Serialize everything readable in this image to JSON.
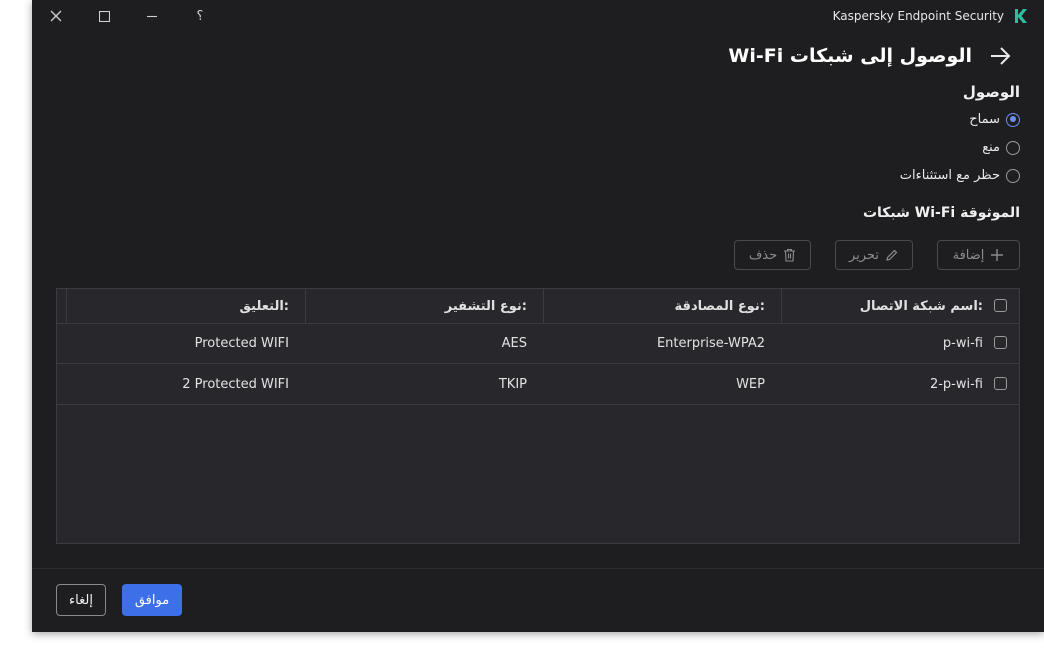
{
  "window": {
    "app_title": "Kaspersky Endpoint Security",
    "help_label": "؟",
    "brand_color": "#29c0a0"
  },
  "page": {
    "title": "الوصول إلى شبكات Wi-Fi"
  },
  "access": {
    "label": "الوصول",
    "options": [
      {
        "label": "سماح",
        "selected": true
      },
      {
        "label": "منع",
        "selected": false
      },
      {
        "label": "حظر مع استثناءات",
        "selected": false
      }
    ]
  },
  "trusted_networks": {
    "label": "شبكات Wi-Fi الموثوقة",
    "toolbar": {
      "add_label": "إضافة",
      "edit_label": "تحرير",
      "delete_label": "حذف"
    },
    "columns": [
      "اسم شبكة الاتصال:",
      "نوع المصادقة:",
      "نوع التشفير:",
      "التعليق:"
    ],
    "rows": [
      {
        "name": "p-wi-fi",
        "auth": "Enterprise-WPA2",
        "encryption": "AES",
        "comment": "Protected WIFI"
      },
      {
        "name": "2-p-wi-fi",
        "auth": "WEP",
        "encryption": "TKIP",
        "comment": "2 Protected WIFI"
      }
    ]
  },
  "footer": {
    "ok_label": "موافق",
    "cancel_label": "إلغاء"
  },
  "colors": {
    "accent": "#3d6fe8",
    "background": "#1e1e20",
    "table_background": "#28282c"
  }
}
